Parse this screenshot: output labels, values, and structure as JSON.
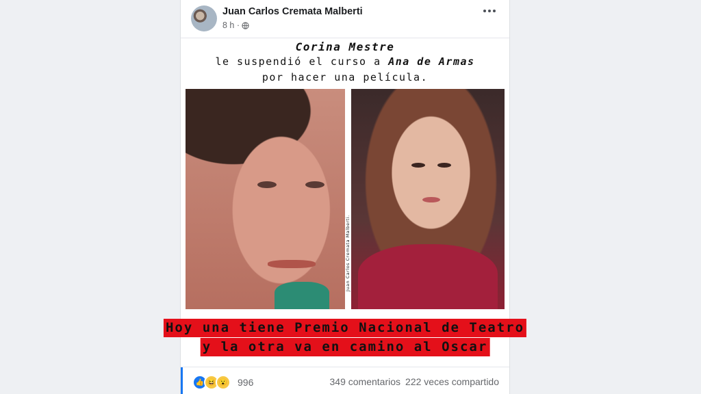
{
  "post": {
    "author": "Juan Carlos Cremata Malberti",
    "time": "8 h ·",
    "audience_icon": "globe-icon",
    "menu_icon": "more-options-icon"
  },
  "image": {
    "headline_line1": "Corina Mestre",
    "headline_line2_a": "le suspendió el curso a ",
    "headline_line2_b": "Ana de Armas",
    "headline_line3": "por hacer una película.",
    "watermark": "Juan Carlos Cremata Malberti.",
    "caption_line1": "Hoy una tiene Premio Nacional de Teatro",
    "caption_line2": "y la otra va en camino al Oscar"
  },
  "footer": {
    "reaction_icons": [
      "like-icon",
      "haha-icon",
      "wow-icon"
    ],
    "reaction_count": "996",
    "comments": "349 comentarios",
    "shares": "222 veces compartido"
  },
  "colors": {
    "caption_bg": "#e4101a",
    "accent": "#1877f2"
  }
}
